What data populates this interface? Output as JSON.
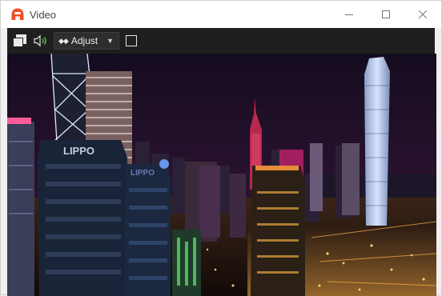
{
  "window": {
    "title": "Video",
    "icons": {
      "app": "app-logo-icon",
      "minimize": "minimize-icon",
      "maximize": "maximize-icon",
      "close": "close-icon"
    }
  },
  "toolbar": {
    "adjust_label": "Adjust",
    "icons": {
      "fullscreen": "window-restore-icon",
      "volume": "speaker-icon",
      "arrows": "arrows-icon",
      "dropdown": "chevron-down-icon"
    }
  },
  "video": {
    "sign_lippo_1": "LIPPO",
    "sign_lippo_2": "LIPPO",
    "colors": {
      "sky": "#1b0f24",
      "accent": "#f04e23"
    }
  }
}
